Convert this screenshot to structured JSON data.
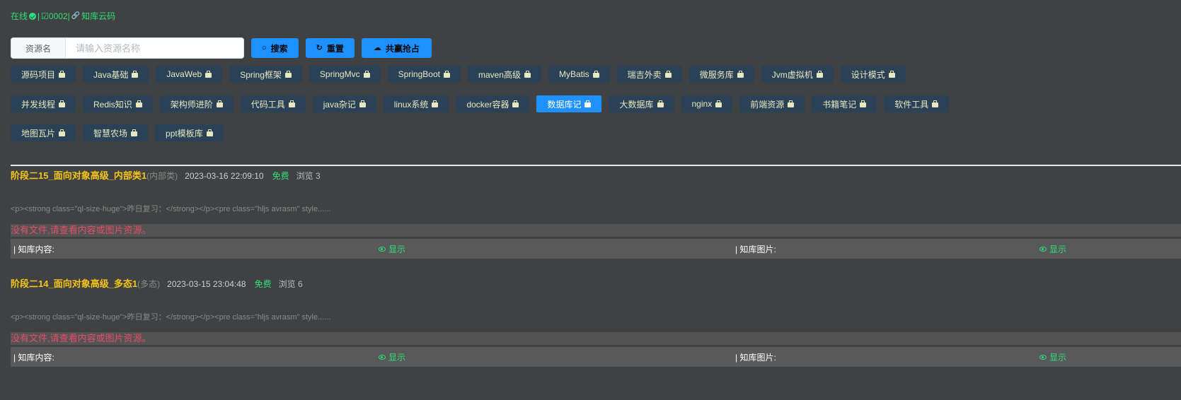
{
  "status": {
    "online": "在线",
    "sep1": "|",
    "count": "☑0002|",
    "link_icon": "🔗",
    "link_label": "知库云码"
  },
  "search": {
    "prefix": "资源名",
    "placeholder": "请输入资源名称"
  },
  "buttons": {
    "search": "搜索",
    "reset": "重置",
    "share": "共赢抢占"
  },
  "tags_row1": [
    "源码项目",
    "Java基础",
    "JavaWeb",
    "Spring框架",
    "SpringMvc",
    "SpringBoot",
    "maven高级",
    "MyBatis",
    "瑞吉外卖",
    "微服务库",
    "Jvm虚拟机",
    "设计模式"
  ],
  "tags_row2": [
    "并发线程",
    "Redis知识",
    "架构师进阶",
    "代码工具",
    "java杂记",
    "linux系统",
    "docker容器",
    "数据库记",
    "大数据库",
    "nginx",
    "前端资源",
    "书籍笔记",
    "软件工具"
  ],
  "tags_row3": [
    "地图瓦片",
    "智慧农场",
    "ppt模板库"
  ],
  "active_tag": "数据库记",
  "posts": [
    {
      "title": "阶段二15_面向对象高级_内部类1",
      "category": "(内部类)",
      "date": "2023-03-16 22:09:10",
      "price": "免费",
      "views": "浏览 3",
      "excerpt": "<p><strong class=\"ql-size-huge\">昨日复习：</strong></p><pre class=\"hljs avrasm\" style......",
      "notice": "没有文件,请查看内容或图片资源。",
      "content_label": "| 知库内容:",
      "image_label": "| 知库图片:",
      "show": "显示"
    },
    {
      "title": "阶段二14_面向对象高级_多态1",
      "category": "(多态)",
      "date": "2023-03-15 23:04:48",
      "price": "免费",
      "views": "浏览 6",
      "excerpt": "<p><strong class=\"ql-size-huge\">昨日复习：</strong></p><pre class=\"hljs avrasm\" style......",
      "notice": "没有文件,请查看内容或图片资源。",
      "content_label": "| 知库内容:",
      "image_label": "| 知库图片:",
      "show": "显示"
    }
  ],
  "colors": {
    "accent": "#1e90ff",
    "tag_bg": "#2a4156",
    "green": "#2ee07a",
    "title": "#f5c518",
    "notice": "#e84c6c"
  }
}
